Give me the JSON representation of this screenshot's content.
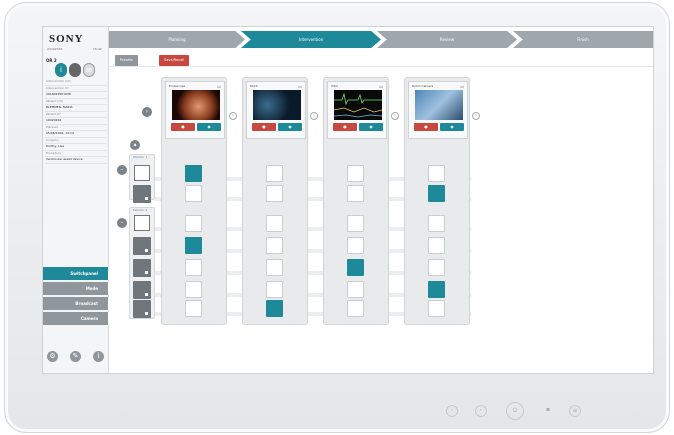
{
  "brand": {
    "logo": "SONY"
  },
  "sidebar": {
    "date": "2/24/2016",
    "time": "15:42",
    "room": "OR 2",
    "patient_rows": [
      {
        "text": "Intervention info",
        "kind": "label"
      },
      {
        "text": "Intervention ID",
        "kind": "label"
      },
      {
        "text": "2016022501638",
        "kind": "val"
      },
      {
        "text": "Patient info",
        "kind": "label"
      },
      {
        "text": "BLEMMEN, MARIA",
        "kind": "val"
      },
      {
        "text": "Patient ID",
        "kind": "label"
      },
      {
        "text": "19920264",
        "kind": "val"
      },
      {
        "text": "Planned",
        "kind": "label"
      },
      {
        "text": "05/06/2016, 14:14",
        "kind": "val"
      },
      {
        "text": "Surgeon",
        "kind": "label"
      },
      {
        "text": "Dorthy, Lisa",
        "kind": "val"
      },
      {
        "text": "Procedure",
        "kind": "label"
      },
      {
        "text": "Ventricular assist device",
        "kind": "val"
      }
    ],
    "nav": [
      {
        "label": "Switchpanel",
        "active": true
      },
      {
        "label": "Mode",
        "active": false
      },
      {
        "label": "Broadcast",
        "active": false
      },
      {
        "label": "Camera",
        "active": false
      }
    ],
    "bottom_icons": [
      "settings-icon",
      "tools-icon",
      "info-icon"
    ]
  },
  "workflow_tabs": [
    {
      "label": "Planning",
      "active": false
    },
    {
      "label": "Intervention",
      "active": true
    },
    {
      "label": "Review",
      "active": false
    },
    {
      "label": "Finish",
      "active": false
    }
  ],
  "toolbar": {
    "primary_label": "Presets",
    "secondary_label": "Save/Recall"
  },
  "devices": [
    {
      "name": "Endoscope",
      "rows": [
        1,
        0,
        0,
        1,
        0,
        0,
        0
      ]
    },
    {
      "name": "PACS",
      "rows": [
        0,
        0,
        0,
        0,
        0,
        0,
        1
      ]
    },
    {
      "name": "Vital",
      "rows": [
        0,
        0,
        0,
        0,
        1,
        0,
        0
      ]
    },
    {
      "name": "Room Camera",
      "rows": [
        0,
        1,
        0,
        0,
        0,
        1,
        0
      ]
    }
  ],
  "monitor_groups": [
    {
      "label": "Monitor 1"
    },
    {
      "label": "Monitor 2"
    }
  ],
  "colors": {
    "accent": "#1e8a99",
    "tab_inactive": "#a0a7ac",
    "nav_inactive": "#8f969c",
    "record": "#c8473e",
    "tool": "#1e8a99"
  }
}
